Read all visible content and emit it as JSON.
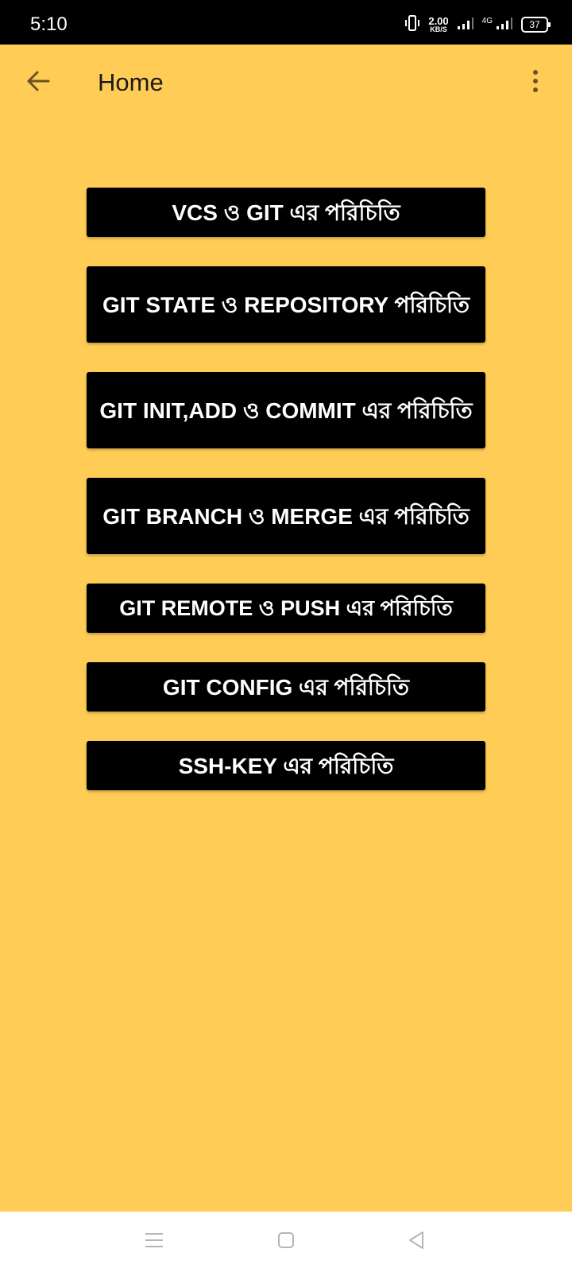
{
  "status_bar": {
    "time": "5:10",
    "speed_value": "2.00",
    "speed_unit": "KB/S",
    "network": "4G",
    "battery": "37",
    "icons": [
      "vibrate-icon",
      "signal-icon",
      "signal-4g-icon",
      "battery-icon"
    ]
  },
  "app_bar": {
    "title": "Home",
    "back_icon": "arrow-left-icon",
    "overflow_icon": "more-vertical-icon"
  },
  "menu": {
    "items": [
      {
        "label": "VCS ও GIT এর পরিচিতি"
      },
      {
        "label": "GIT STATE ও REPOSITORY পরিচিতি"
      },
      {
        "label": "GIT INIT,ADD ও COMMIT এর পরিচিতি"
      },
      {
        "label": "GIT BRANCH ও MERGE এর পরিচিতি"
      },
      {
        "label": "GIT REMOTE ও PUSH এর পরিচিতি"
      },
      {
        "label": "GIT CONFIG এর পরিচিতি"
      },
      {
        "label": "SSH-KEY এর পরিচিতি"
      }
    ]
  },
  "nav_bar": {
    "icons": [
      "menu-icon",
      "home-square-icon",
      "back-triangle-icon"
    ]
  },
  "colors": {
    "background": "#ffcc55",
    "button": "#000000",
    "button_text": "#ffffff",
    "title_text": "#1b1b1b",
    "icon": "#6b5225"
  }
}
